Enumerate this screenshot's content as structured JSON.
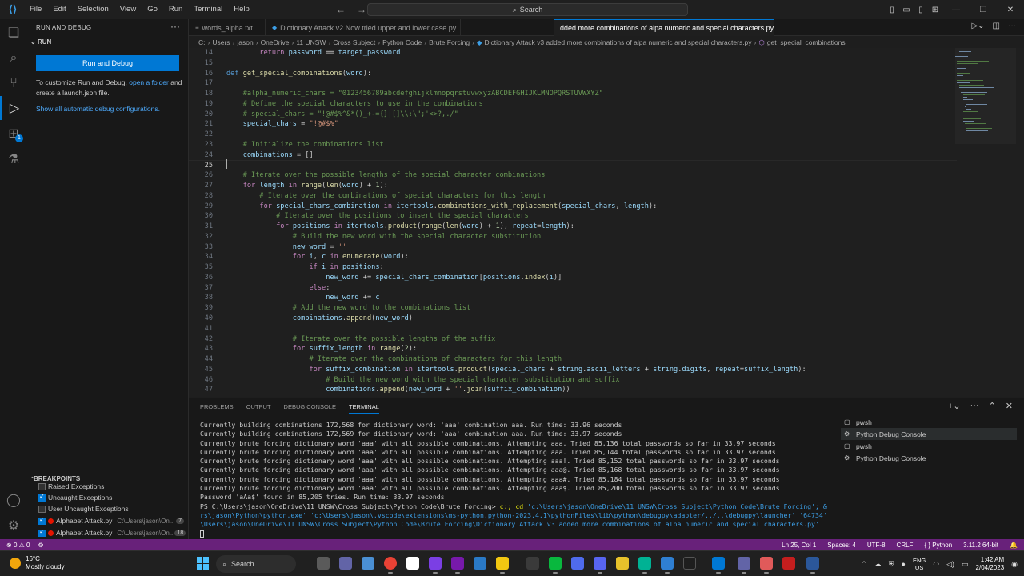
{
  "titlebar": {
    "menu": [
      "File",
      "Edit",
      "Selection",
      "View",
      "Go",
      "Run",
      "Terminal",
      "Help"
    ],
    "search_placeholder": "Search"
  },
  "sidebar": {
    "title": "RUN AND DEBUG",
    "section": "RUN",
    "run_button": "Run and Debug",
    "hint_prefix": "To customize Run and Debug, ",
    "hint_link": "open a folder",
    "hint_suffix": " and create a launch.json file.",
    "show_all": "Show all automatic debug configurations.",
    "breakpoints_title": "BREAKPOINTS",
    "breakpoints": [
      {
        "label": "Raised Exceptions",
        "checked": false
      },
      {
        "label": "Uncaught Exceptions",
        "checked": true
      },
      {
        "label": "User Uncaught Exceptions",
        "checked": false
      }
    ],
    "breakpoint_files": [
      {
        "file": "Alphabet Attack.py",
        "path": "C:\\Users\\jason\\On...",
        "line": "7"
      },
      {
        "file": "Alphabet Attack.py",
        "path": "C:\\Users\\jason\\On...",
        "line": "18"
      }
    ],
    "extensions_badge": "1"
  },
  "tabs": [
    {
      "label": "words_alpha.txt",
      "kind": "txt"
    },
    {
      "label": "Dictionary Attack v2 Now tried upper and lower case.py",
      "kind": "py"
    },
    {
      "label": "dded more combinations of alpa numeric and special characters.py",
      "kind": "py",
      "active": true
    }
  ],
  "breadcrumb": [
    "C:",
    "Users",
    "jason",
    "OneDrive",
    "11 UNSW",
    "Cross Subject",
    "Python Code",
    "Brute Forcing",
    "Dictionary Attack v3 added more combinations of alpa numeric and special characters.py",
    "get_special_combinations"
  ],
  "editor": {
    "lines": [
      {
        "n": "14",
        "html": "        <span class='kc'>return</span> <span class='vr'>password</span> <span class='op'>==</span> <span class='vr'>target_password</span>"
      },
      {
        "n": "15",
        "html": ""
      },
      {
        "n": "16",
        "html": "<span class='kw'>def</span> <span class='fn'>get_special_combinations</span>(<span class='vr'>word</span>):"
      },
      {
        "n": "17",
        "html": ""
      },
      {
        "n": "18",
        "html": "    <span class='cm'>#alpha_numeric_chars = \"0123456789abcdefghijklmnopqrstuvwxyzABCDEFGHIJKLMNOPQRSTUVWXYZ\"</span>"
      },
      {
        "n": "19",
        "html": "    <span class='cm'># Define the special characters to use in the combinations</span>"
      },
      {
        "n": "20",
        "html": "    <span class='cm'># special_chars = \"!@#$%^&*()_+-={}|[]\\\\:\\\";'<>?,./\"</span>"
      },
      {
        "n": "21",
        "html": "    <span class='vr'>special_chars</span> <span class='op'>=</span> <span class='st'>\"!@#$%\"</span>"
      },
      {
        "n": "22",
        "html": ""
      },
      {
        "n": "23",
        "html": "    <span class='cm'># Initialize the combinations list</span>"
      },
      {
        "n": "24",
        "html": "    <span class='vr'>combinations</span> <span class='op'>=</span> []"
      },
      {
        "n": "25",
        "html": "",
        "cur": true
      },
      {
        "n": "26",
        "html": "    <span class='cm'># Iterate over the possible lengths of the special character combinations</span>"
      },
      {
        "n": "27",
        "html": "    <span class='kc'>for</span> <span class='vr'>length</span> <span class='kc'>in</span> <span class='fn'>range</span>(<span class='fn'>len</span>(<span class='vr'>word</span>) <span class='op'>+</span> <span class='nm'>1</span>):"
      },
      {
        "n": "28",
        "html": "        <span class='cm'># Iterate over the combinations of special characters for this length</span>"
      },
      {
        "n": "29",
        "html": "        <span class='kc'>for</span> <span class='vr'>special_chars_combination</span> <span class='kc'>in</span> <span class='vr'>itertools</span>.<span class='fn'>combinations_with_replacement</span>(<span class='vr'>special_chars</span>, <span class='vr'>length</span>):"
      },
      {
        "n": "30",
        "html": "            <span class='cm'># Iterate over the positions to insert the special characters</span>"
      },
      {
        "n": "31",
        "html": "            <span class='kc'>for</span> <span class='vr'>positions</span> <span class='kc'>in</span> <span class='vr'>itertools</span>.<span class='fn'>product</span>(<span class='fn'>range</span>(<span class='fn'>len</span>(<span class='vr'>word</span>) <span class='op'>+</span> <span class='nm'>1</span>), <span class='vr'>repeat</span><span class='op'>=</span><span class='vr'>length</span>):"
      },
      {
        "n": "32",
        "html": "                <span class='cm'># Build the new word with the special character substitution</span>"
      },
      {
        "n": "33",
        "html": "                <span class='vr'>new_word</span> <span class='op'>=</span> <span class='st'>''</span>"
      },
      {
        "n": "34",
        "html": "                <span class='kc'>for</span> <span class='vr'>i</span>, <span class='vr'>c</span> <span class='kc'>in</span> <span class='fn'>enumerate</span>(<span class='vr'>word</span>):"
      },
      {
        "n": "35",
        "html": "                    <span class='kc'>if</span> <span class='vr'>i</span> <span class='kc'>in</span> <span class='vr'>positions</span>:"
      },
      {
        "n": "36",
        "html": "                        <span class='vr'>new_word</span> <span class='op'>+=</span> <span class='vr'>special_chars_combination</span>[<span class='vr'>positions</span>.<span class='fn'>index</span>(<span class='vr'>i</span>)]"
      },
      {
        "n": "37",
        "html": "                    <span class='kc'>else</span>:"
      },
      {
        "n": "38",
        "html": "                        <span class='vr'>new_word</span> <span class='op'>+=</span> <span class='vr'>c</span>"
      },
      {
        "n": "39",
        "html": "                <span class='cm'># Add the new word to the combinations list</span>"
      },
      {
        "n": "40",
        "html": "                <span class='vr'>combinations</span>.<span class='fn'>append</span>(<span class='vr'>new_word</span>)"
      },
      {
        "n": "41",
        "html": ""
      },
      {
        "n": "42",
        "html": "                <span class='cm'># Iterate over the possible lengths of the suffix</span>"
      },
      {
        "n": "43",
        "html": "                <span class='kc'>for</span> <span class='vr'>suffix_length</span> <span class='kc'>in</span> <span class='fn'>range</span>(<span class='nm'>2</span>):"
      },
      {
        "n": "44",
        "html": "                    <span class='cm'># Iterate over the combinations of characters for this length</span>"
      },
      {
        "n": "45",
        "html": "                    <span class='kc'>for</span> <span class='vr'>suffix_combination</span> <span class='kc'>in</span> <span class='vr'>itertools</span>.<span class='fn'>product</span>(<span class='vr'>special_chars</span> <span class='op'>+</span> <span class='vr'>string</span>.<span class='vr'>ascii_letters</span> <span class='op'>+</span> <span class='vr'>string</span>.<span class='vr'>digits</span>, <span class='vr'>repeat</span><span class='op'>=</span><span class='vr'>suffix_length</span>):"
      },
      {
        "n": "46",
        "html": "                        <span class='cm'># Build the new word with the special character substitution and suffix</span>"
      },
      {
        "n": "47",
        "html": "                        <span class='vr'>combinations</span>.<span class='fn'>append</span>(<span class='vr'>new_word</span> <span class='op'>+</span> <span class='st'>''</span>.<span class='fn'>join</span>(<span class='vr'>suffix_combination</span>))"
      }
    ]
  },
  "panel": {
    "tabs": [
      "PROBLEMS",
      "OUTPUT",
      "DEBUG CONSOLE",
      "TERMINAL"
    ],
    "active_tab": "TERMINAL",
    "terminal_lines": [
      "Currently building combinations 172,568 for dictionary word: 'aaa' combination aaa. Run time: 33.96 seconds",
      "Currently building combinations 172,569 for dictionary word: 'aaa' combination aaa. Run time: 33.97 seconds",
      "Currently brute forcing dictionary word 'aaa' with all possible combinations. Attempting aaa. Tried 85,136 total passwords so far in 33.97 seconds",
      "Currently brute forcing dictionary word 'aaa' with all possible combinations. Attempting aaa. Tried 85,144 total passwords so far in 33.97 seconds",
      "Currently brute forcing dictionary word 'aaa' with all possible combinations. Attempting aaa!. Tried 85,152 total passwords so far in 33.97 seconds",
      "Currently brute forcing dictionary word 'aaa' with all possible combinations. Attempting aaa@. Tried 85,168 total passwords so far in 33.97 seconds",
      "Currently brute forcing dictionary word 'aaa' with all possible combinations. Attempting aaa#. Tried 85,184 total passwords so far in 33.97 seconds",
      "Currently brute forcing dictionary word 'aaa' with all possible combinations. Attempting aaa$. Tried 85,200 total passwords so far in 33.97 seconds",
      "Password 'aAa$' found in 85,205 tries. Run time: 33.97 seconds"
    ],
    "prompt": "PS C:\\Users\\jason\\OneDrive\\11 UNSW\\Cross Subject\\Python Code\\Brute Forcing> ",
    "command_start": "c:; cd",
    "command_arg": " 'c:\\Users\\jason\\OneDrive\\11 UNSW\\Cross Subject\\Python Code\\Brute Forcing'; & 'C:\\Use",
    "command_cont1": "rs\\jason\\Python\\python.exe' 'c:\\Users\\jason\\.vscode\\extensions\\ms-python.python-2023.4.1\\pythonFiles\\lib\\python\\debugpy\\adapter/../..\\debugpy\\launcher' '64734' '--' 'c:",
    "command_cont2": "\\Users\\jason\\OneDrive\\11 UNSW\\Cross Subject\\Python Code\\Brute Forcing\\Dictionary Attack v3 added more combinations of alpa numeric and special characters.py'",
    "terminals": [
      "pwsh",
      "Python Debug Console",
      "pwsh",
      "Python Debug Console"
    ]
  },
  "statusbar": {
    "errors": "0",
    "warnings": "0",
    "position": "Ln 25, Col 1",
    "spaces": "Spaces: 4",
    "encoding": "UTF-8",
    "eol": "CRLF",
    "language": "Python",
    "interpreter": "3.11.2 64-bit"
  },
  "taskbar": {
    "temp": "16°C",
    "weather": "Mostly cloudy",
    "search": "Search",
    "lang1": "ENG",
    "lang2": "US",
    "time": "1:42 AM",
    "date": "2/04/2023"
  },
  "colors": {
    "accent": "#0078d4",
    "statusbar": "#68217a",
    "breakpoint": "#e51400"
  }
}
